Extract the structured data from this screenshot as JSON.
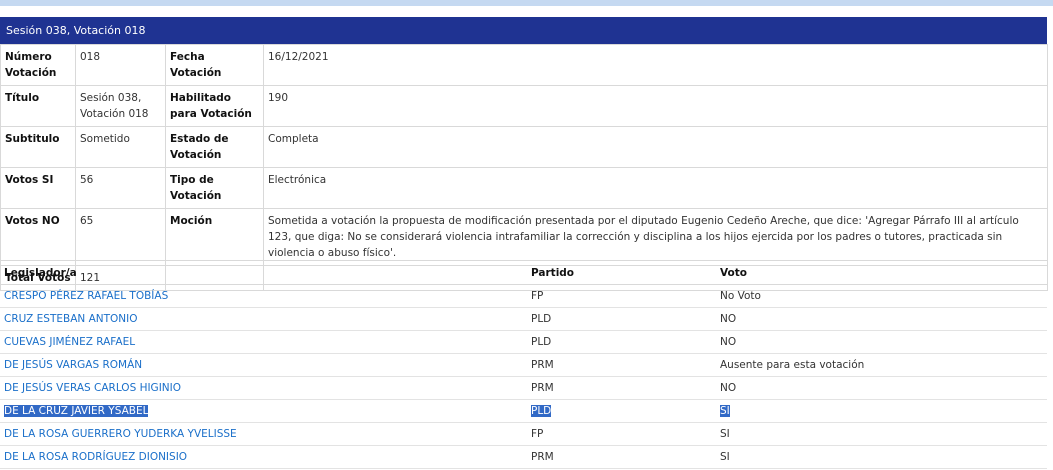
{
  "header": {
    "title": "Sesión 038, Votación 018"
  },
  "details": {
    "numero_label": "Número Votación",
    "numero_value": "018",
    "fecha_label": "Fecha Votación",
    "fecha_value": "16/12/2021",
    "titulo_label": "Título",
    "titulo_value": "Sesión 038, Votación 018",
    "habilitado_label": "Habilitado para Votación",
    "habilitado_value": "190",
    "subtitulo_label": "Subtitulo",
    "subtitulo_value": "Sometido",
    "estado_label": "Estado de Votación",
    "estado_value": "Completa",
    "votos_si_label": "Votos SI",
    "votos_si_value": "56",
    "tipo_label": "Tipo de Votación",
    "tipo_value": "Electrónica",
    "votos_no_label": "Votos NO",
    "votos_no_value": "65",
    "mocion_label": "Moción",
    "mocion_value": "Sometida a votación la propuesta de modificación presentada por el diputado Eugenio Cedeño Areche, que dice: 'Agregar Párrafo III al artículo 123, que diga: No se considerará violencia intrafamiliar la corrección y disciplina a los hijos ejercida por los padres o tutores, practicada sin violencia o abuso físico'.",
    "total_label": "Total Votos",
    "total_value": "121"
  },
  "votes": {
    "columns": [
      "Legislador/a",
      "Partido",
      "Voto"
    ],
    "rows": [
      {
        "name": "CRESPO PÉREZ RAFAEL TOBÍAS",
        "party": "FP",
        "vote": "No Voto"
      },
      {
        "name": "CRUZ ESTEBAN ANTONIO",
        "party": "PLD",
        "vote": "NO"
      },
      {
        "name": "CUEVAS JIMÉNEZ RAFAEL",
        "party": "PLD",
        "vote": "NO"
      },
      {
        "name": "DE JESÚS VARGAS ROMÁN",
        "party": "PRM",
        "vote": "Ausente para esta votación"
      },
      {
        "name": "DE JESÚS VERAS CARLOS HIGINIO",
        "party": "PRM",
        "vote": "NO"
      },
      {
        "name": "DE LA CRUZ JAVIER YSABEL",
        "party": "PLD",
        "vote": "SI"
      },
      {
        "name": "DE LA ROSA GUERRERO YUDERKA YVELISSE",
        "party": "FP",
        "vote": "SI"
      },
      {
        "name": "DE LA ROSA RODRÍGUEZ DIONISIO",
        "party": "PRM",
        "vote": "SI"
      }
    ]
  },
  "colors": {
    "header_bg": "#1f3392",
    "link": "#1a6fc9",
    "selection": "#3169c6",
    "top_strip": "#c5d9f1"
  }
}
